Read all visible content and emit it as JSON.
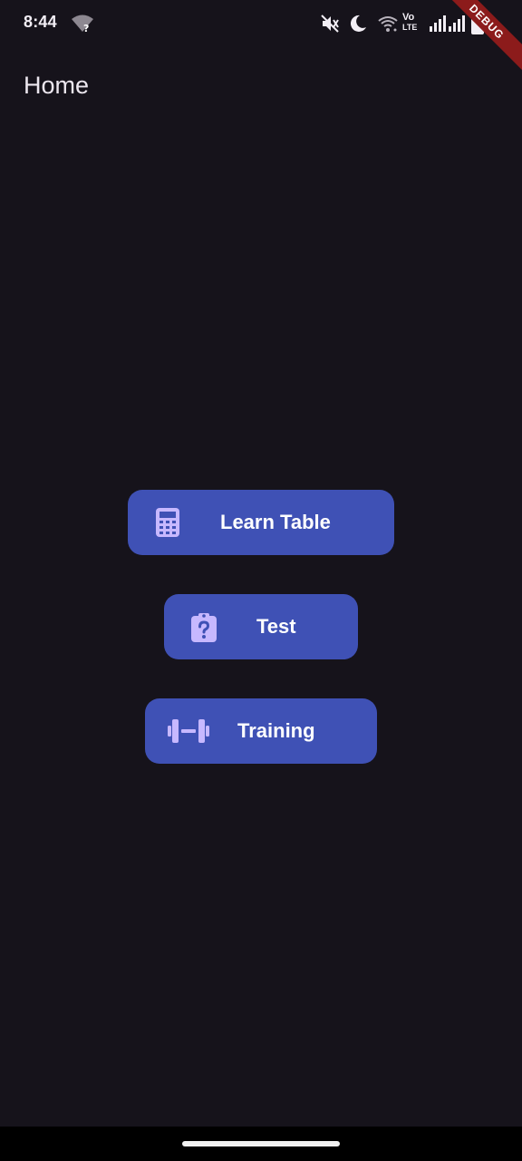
{
  "status_bar": {
    "time": "8:44",
    "icons": [
      "wifi-unknown-icon",
      "mute-icon",
      "do-not-disturb-moon-icon",
      "wifi-calling-icon",
      "volte-icon",
      "signal-icon",
      "signal-icon",
      "battery-icon"
    ],
    "volte_top": "Vo",
    "volte_bottom": "LTE",
    "debug_banner": "DEBUG"
  },
  "app_bar": {
    "title": "Home"
  },
  "buttons": [
    {
      "label": "Learn Table",
      "icon": "calculator-icon"
    },
    {
      "label": "Test",
      "icon": "quiz-clipboard-icon"
    },
    {
      "label": "Training",
      "icon": "dumbbell-icon"
    }
  ],
  "colors": {
    "background": "#16131b",
    "button": "#3f51b5",
    "button_icon": "#c7b8ff",
    "button_text": "#ffffff",
    "debug_banner": "#8c1b1b"
  }
}
